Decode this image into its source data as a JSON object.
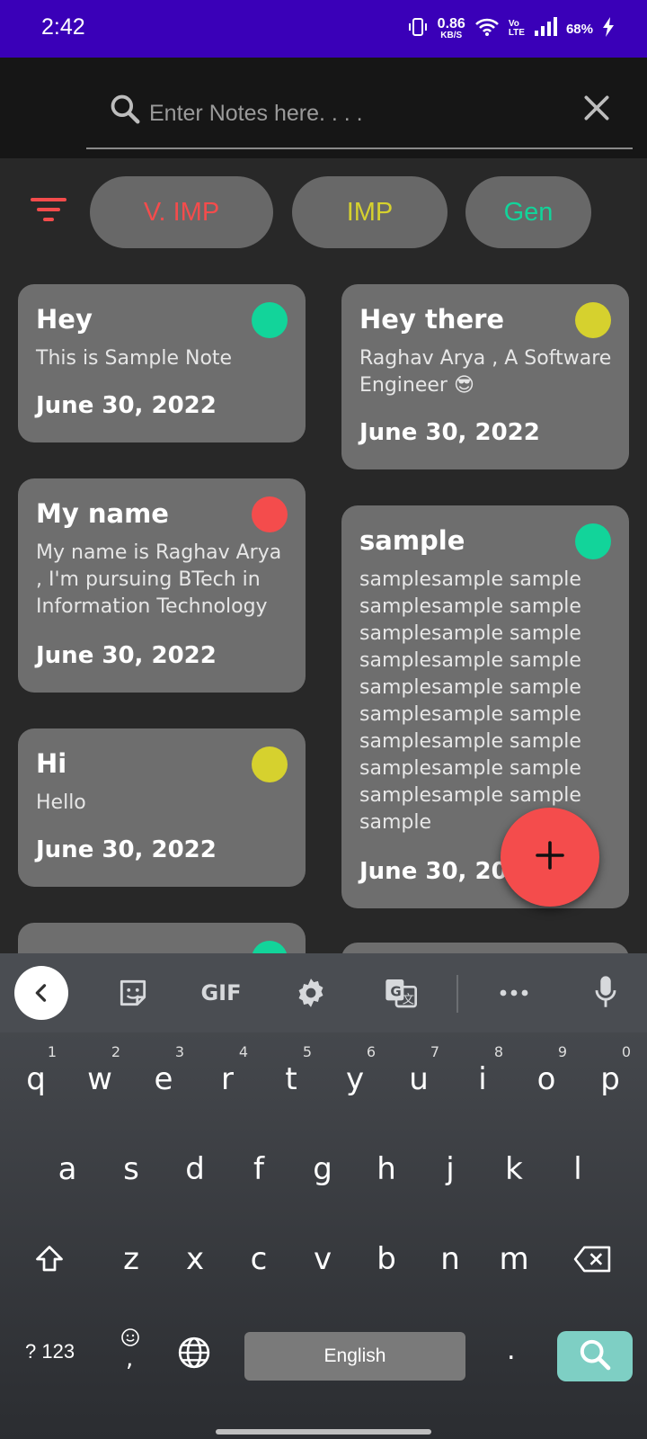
{
  "status_bar": {
    "time": "2:42",
    "net_speed_value": "0.86",
    "net_speed_unit": "KB/S",
    "volte_top": "Vo",
    "volte_bottom": "LTE",
    "battery": "68%"
  },
  "search": {
    "placeholder": "Enter Notes here. . . ."
  },
  "filters": [
    {
      "label": "V. IMP",
      "color": "#F44C4C"
    },
    {
      "label": "IMP",
      "color": "#D6D12E"
    },
    {
      "label": "Gen",
      "color": "#12D49A"
    }
  ],
  "notes": [
    {
      "title": "Hey",
      "body": "This is Sample Note",
      "date": "June 30, 2022",
      "priority_color": "#12D49A"
    },
    {
      "title": "Hey there",
      "body": "Raghav Arya , A Software Engineer 😎",
      "date": "June 30, 2022",
      "priority_color": "#D6D12E"
    },
    {
      "title": "My name",
      "body": "My name is Raghav Arya , I'm pursuing BTech in Information Technology",
      "date": "June 30, 2022",
      "priority_color": "#F44C4C"
    },
    {
      "title": "sample",
      "body": "samplesample sample samplesample sample samplesample sample samplesample sample samplesample sample samplesample sample samplesample sample samplesample sample samplesample sample sample",
      "date": "June 30, 2022",
      "priority_color": "#12D49A"
    },
    {
      "title": "Hi",
      "body": "Hello",
      "date": "June 30, 2022",
      "priority_color": "#D6D12E"
    },
    {
      "title": "",
      "priority_color": "#12D49A"
    }
  ],
  "keyboard": {
    "row1": [
      {
        "key": "q",
        "hint": "1"
      },
      {
        "key": "w",
        "hint": "2"
      },
      {
        "key": "e",
        "hint": "3"
      },
      {
        "key": "r",
        "hint": "4"
      },
      {
        "key": "t",
        "hint": "5"
      },
      {
        "key": "y",
        "hint": "6"
      },
      {
        "key": "u",
        "hint": "7"
      },
      {
        "key": "i",
        "hint": "8"
      },
      {
        "key": "o",
        "hint": "9"
      },
      {
        "key": "p",
        "hint": "0"
      }
    ],
    "row2": [
      "a",
      "s",
      "d",
      "f",
      "g",
      "h",
      "j",
      "k",
      "l"
    ],
    "row3": [
      "z",
      "x",
      "c",
      "v",
      "b",
      "n",
      "m"
    ],
    "symbols_label": "? 123",
    "comma": ",",
    "space_label": "English",
    "period": ".",
    "gif_label": "GIF"
  }
}
